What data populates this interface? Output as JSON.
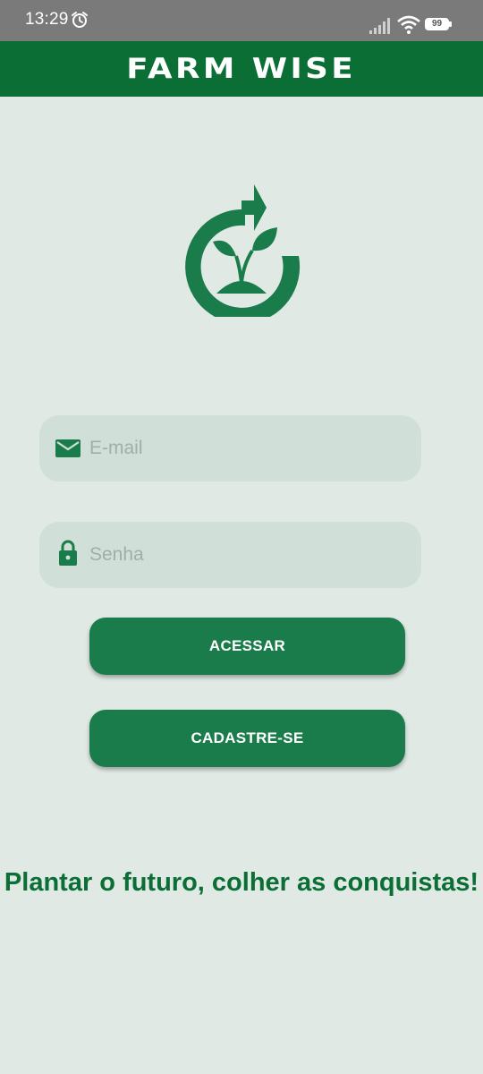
{
  "status_bar": {
    "time": "13:29",
    "battery_level": "99",
    "icons": [
      "alarm-icon",
      "signal-icon",
      "wifi-icon",
      "battery-icon"
    ]
  },
  "header": {
    "title": "FARM WISE"
  },
  "logo": {
    "icon": "sprout-cycle-icon"
  },
  "form": {
    "email": {
      "placeholder": "E-mail",
      "value": "",
      "icon": "mail-icon"
    },
    "password": {
      "placeholder": "Senha",
      "value": "",
      "icon": "lock-icon"
    },
    "access_button": "ACESSAR",
    "register_button": "CADASTRE-SE"
  },
  "slogan": "Plantar o futuro, colher as conquistas!",
  "colors": {
    "brand_green": "#0a6e35",
    "button_green": "#1b7c4b",
    "background": "#e0e9e4",
    "field_background": "#d0dfd8",
    "status_bar": "#7a7a7a"
  }
}
